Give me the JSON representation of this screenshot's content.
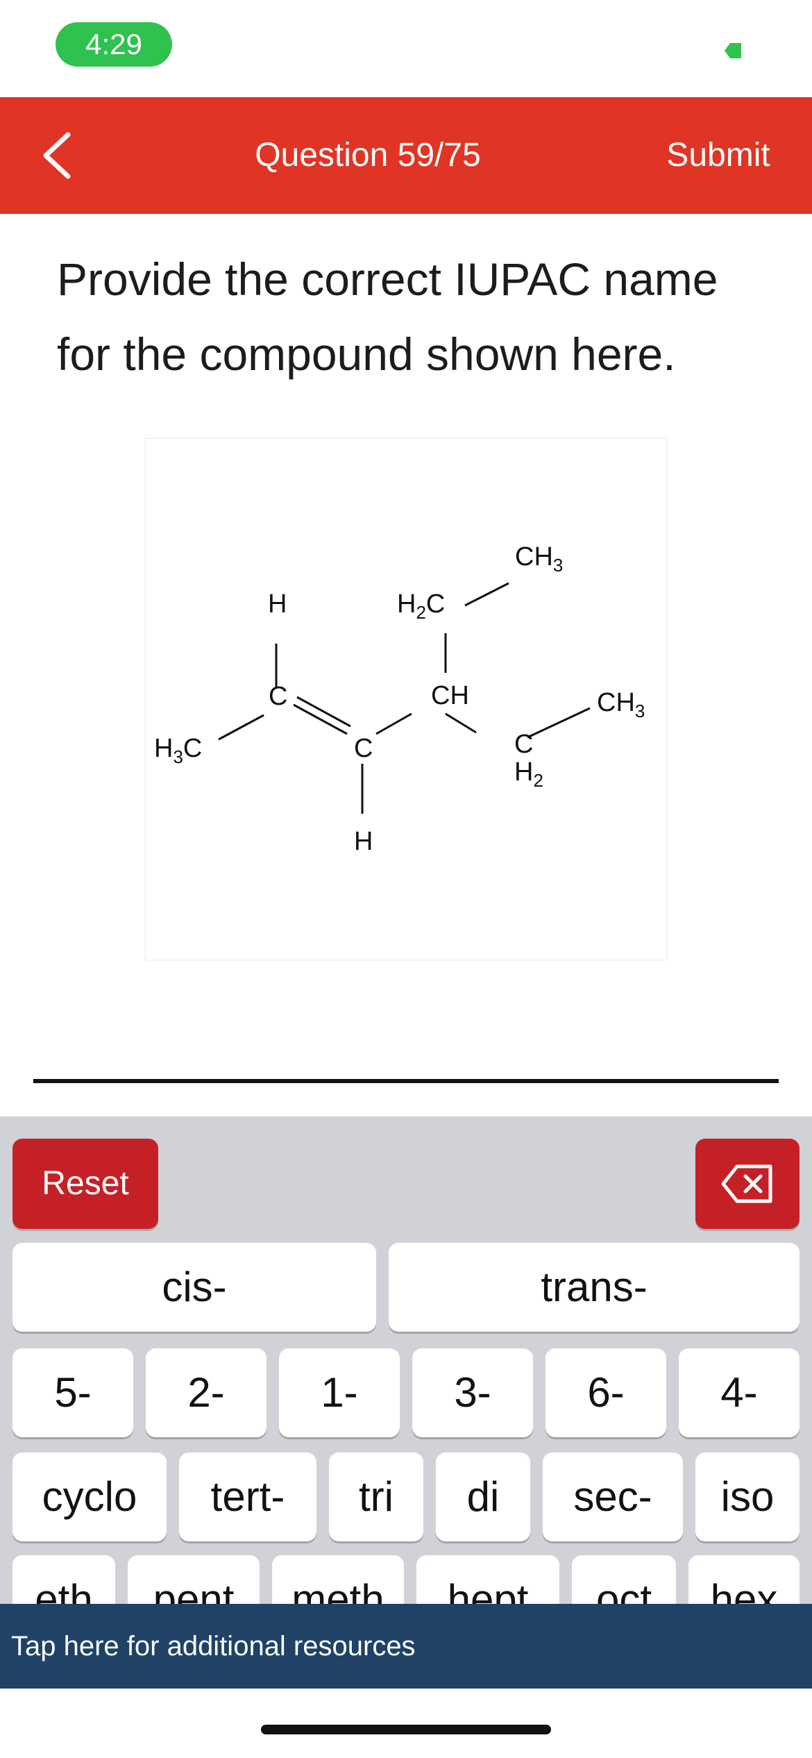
{
  "status_bar": {
    "time": "4:29",
    "indicator_color": "#30c24e"
  },
  "header": {
    "back_icon": "chevron-left-icon",
    "title": "Question 59/75",
    "submit_label": "Submit",
    "background_color": "#e03424"
  },
  "question": {
    "line1": "Provide the correct IUPAC name",
    "line2": "for the compound shown here."
  },
  "structure": {
    "labels": {
      "h3c_left": "H3C",
      "c1": "C",
      "c2": "C",
      "h_top": "H",
      "h_bottom": "H",
      "ch": "CH",
      "h2c_top": "H2C",
      "ch3_top": "CH3",
      "c_h2": "C",
      "h2_under": "H2",
      "ch3_right": "CH3"
    }
  },
  "answer": {
    "value": ""
  },
  "keyboard": {
    "reset_label": "Reset",
    "backspace_icon": "backspace-icon",
    "row_a": [
      "cis-",
      "trans-"
    ],
    "row_b": [
      "5-",
      "2-",
      "1-",
      "3-",
      "6-",
      "4-"
    ],
    "row_c": [
      "cyclo",
      "tert-",
      "tri",
      "di",
      "sec-",
      "iso"
    ],
    "row_d": [
      "eth",
      "pent",
      "meth",
      "hept",
      "oct",
      "hex"
    ],
    "accent_color": "#c62027"
  },
  "resources": {
    "label": "Tap here for additional resources",
    "background_color": "#1f4266"
  }
}
